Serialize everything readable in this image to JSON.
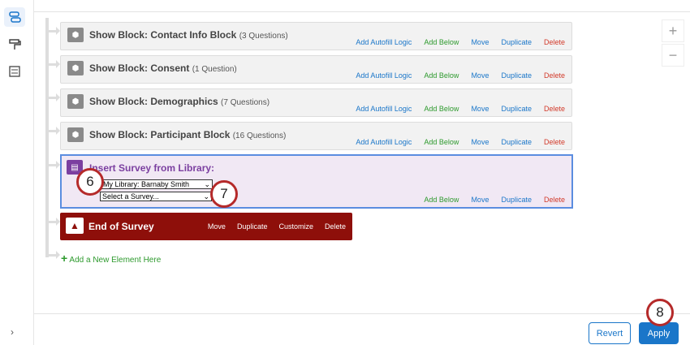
{
  "sidebar": {
    "items": [
      {
        "icon": "survey-flow-icon",
        "active": true
      },
      {
        "icon": "paint-roller-icon"
      },
      {
        "icon": "settings-sliders-icon"
      }
    ],
    "expand_icon": "chevron-right-icon"
  },
  "blocks": [
    {
      "title": "Show Block: Contact Info Block",
      "count": "(3 Questions)"
    },
    {
      "title": "Show Block: Consent",
      "count": "(1 Question)"
    },
    {
      "title": "Show Block: Demographics",
      "count": "(7 Questions)"
    },
    {
      "title": "Show Block: Participant Block",
      "count": "(16 Questions)"
    }
  ],
  "block_actions": {
    "autofill": "Add Autofill Logic",
    "add_below": "Add Below",
    "move": "Move",
    "duplicate": "Duplicate",
    "delete": "Delete"
  },
  "insert": {
    "title": "Insert Survey from Library:",
    "library_select": "My Library: Barnaby Smith",
    "survey_select": "Select a Survey...",
    "add_below": "Add Below",
    "move": "Move",
    "duplicate": "Duplicate",
    "delete": "Delete"
  },
  "end": {
    "title": "End of Survey",
    "move": "Move",
    "duplicate": "Duplicate",
    "customize": "Customize",
    "delete": "Delete"
  },
  "add_element": "Add a New Element Here",
  "zoom": {
    "in": "+",
    "out": "−"
  },
  "footer": {
    "revert": "Revert",
    "apply": "Apply"
  },
  "callouts": [
    "6",
    "7",
    "8"
  ],
  "colors": {
    "accent": "#1a76c9",
    "end": "#8e0f0a",
    "insert": "#7b3fa0",
    "callout": "#b52a2a"
  }
}
